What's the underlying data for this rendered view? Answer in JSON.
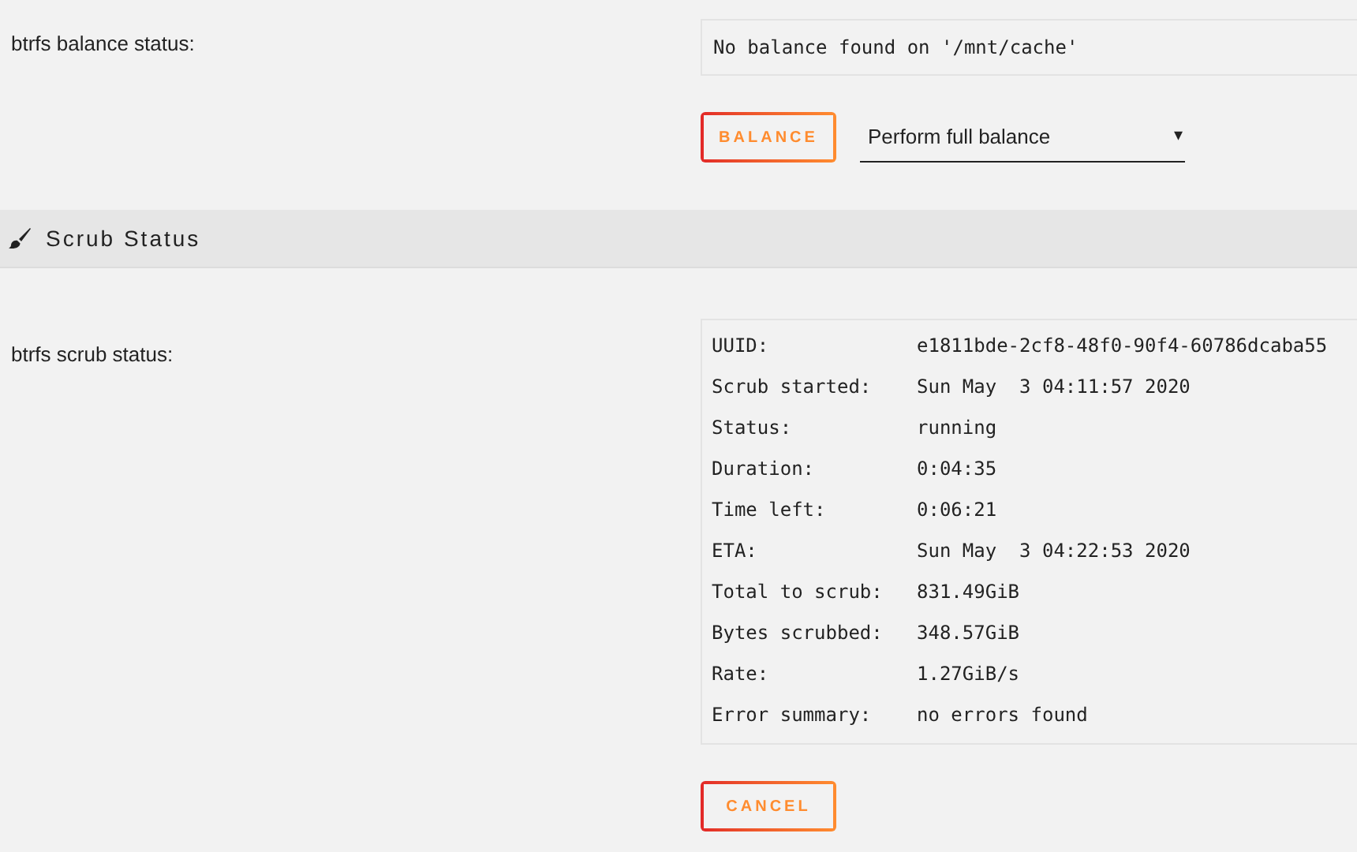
{
  "balance": {
    "label": "btrfs balance status:",
    "status": "No balance found on '/mnt/cache'",
    "button": "BALANCE",
    "mode_select": {
      "value": "Perform full balance",
      "caret": "▾"
    }
  },
  "scrub_section": {
    "title": "Scrub Status"
  },
  "scrub": {
    "label": "btrfs scrub status:",
    "rows": [
      {
        "key": "UUID:",
        "value": "e1811bde-2cf8-48f0-90f4-60786dcaba55"
      },
      {
        "key": "Scrub started:",
        "value": "Sun May  3 04:11:57 2020"
      },
      {
        "key": "Status:",
        "value": "running"
      },
      {
        "key": "Duration:",
        "value": "0:04:35"
      },
      {
        "key": "Time left:",
        "value": "0:06:21"
      },
      {
        "key": "ETA:",
        "value": "Sun May  3 04:22:53 2020"
      },
      {
        "key": "Total to scrub:",
        "value": "831.49GiB"
      },
      {
        "key": "Bytes scrubbed:",
        "value": "348.57GiB"
      },
      {
        "key": "Rate:",
        "value": "1.27GiB/s"
      },
      {
        "key": "Error summary:",
        "value": "no errors found"
      }
    ],
    "button": "CANCEL"
  }
}
